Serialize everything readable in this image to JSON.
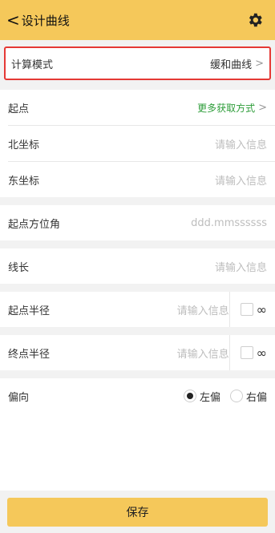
{
  "header": {
    "back_chevron": "<",
    "title": "设计曲线",
    "settings_icon": "gear-icon"
  },
  "mode": {
    "label": "计算模式",
    "value": "缓和曲线",
    "arrow": ">"
  },
  "start": {
    "label": "起点",
    "more_link": "更多获取方式",
    "arrow": ">"
  },
  "north": {
    "label": "北坐标",
    "placeholder": "请输入信息"
  },
  "east": {
    "label": "东坐标",
    "placeholder": "请输入信息"
  },
  "azimuth": {
    "label": "起点方位角",
    "placeholder": "ddd.mmssssss"
  },
  "length": {
    "label": "线长",
    "placeholder": "请输入信息"
  },
  "start_radius": {
    "label": "起点半径",
    "placeholder": "请输入信息",
    "infinity": "∞"
  },
  "end_radius": {
    "label": "终点半径",
    "placeholder": "请输入信息",
    "infinity": "∞"
  },
  "direction": {
    "label": "偏向",
    "left": "左偏",
    "right": "右偏",
    "selected": "left"
  },
  "save_label": "保存",
  "colors": {
    "accent": "#f5c85a",
    "highlight_border": "#e53935",
    "link_green": "#2e9d3a"
  }
}
